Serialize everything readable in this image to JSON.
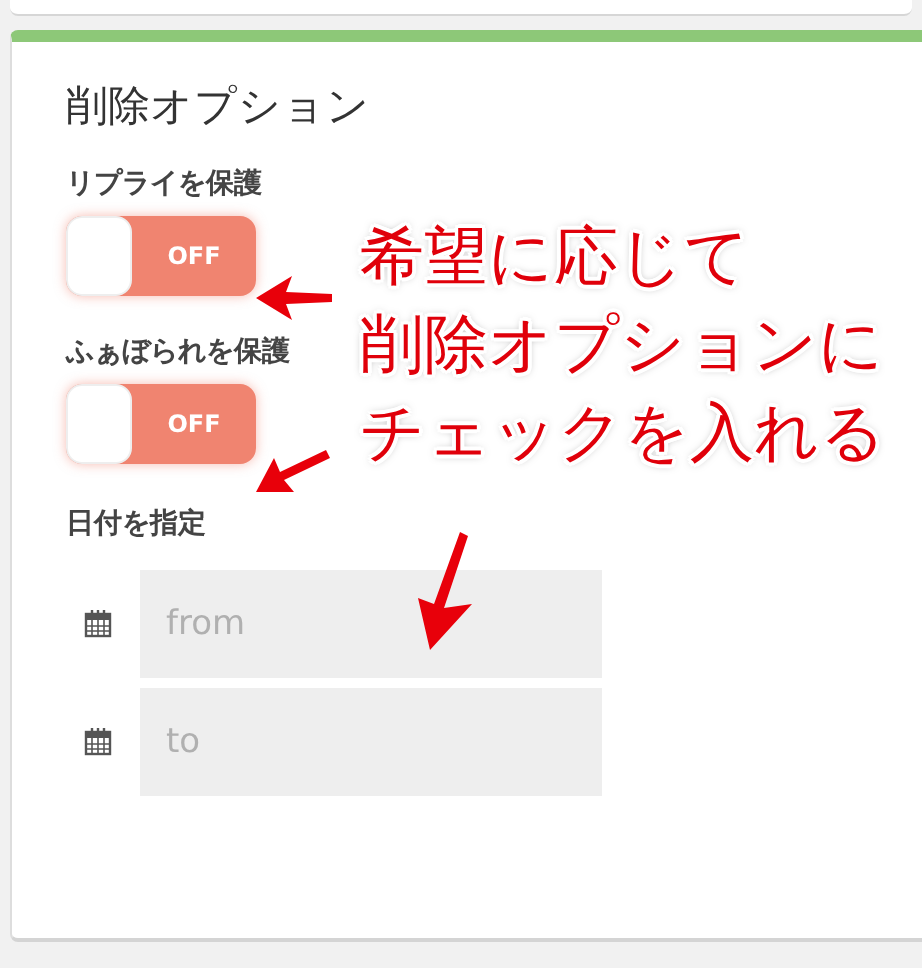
{
  "section": {
    "title": "削除オプション",
    "toggles": [
      {
        "label": "リプライを保護",
        "on": false,
        "state_text": "OFF"
      },
      {
        "label": "ふぁぼられを保護",
        "on": false,
        "state_text": "OFF"
      }
    ],
    "date": {
      "label": "日付を指定",
      "fields": [
        {
          "placeholder": "from"
        },
        {
          "placeholder": "to"
        }
      ]
    }
  },
  "annotation": {
    "lines": [
      "希望に応じて",
      "削除オプションに",
      "チェックを入れる"
    ]
  }
}
